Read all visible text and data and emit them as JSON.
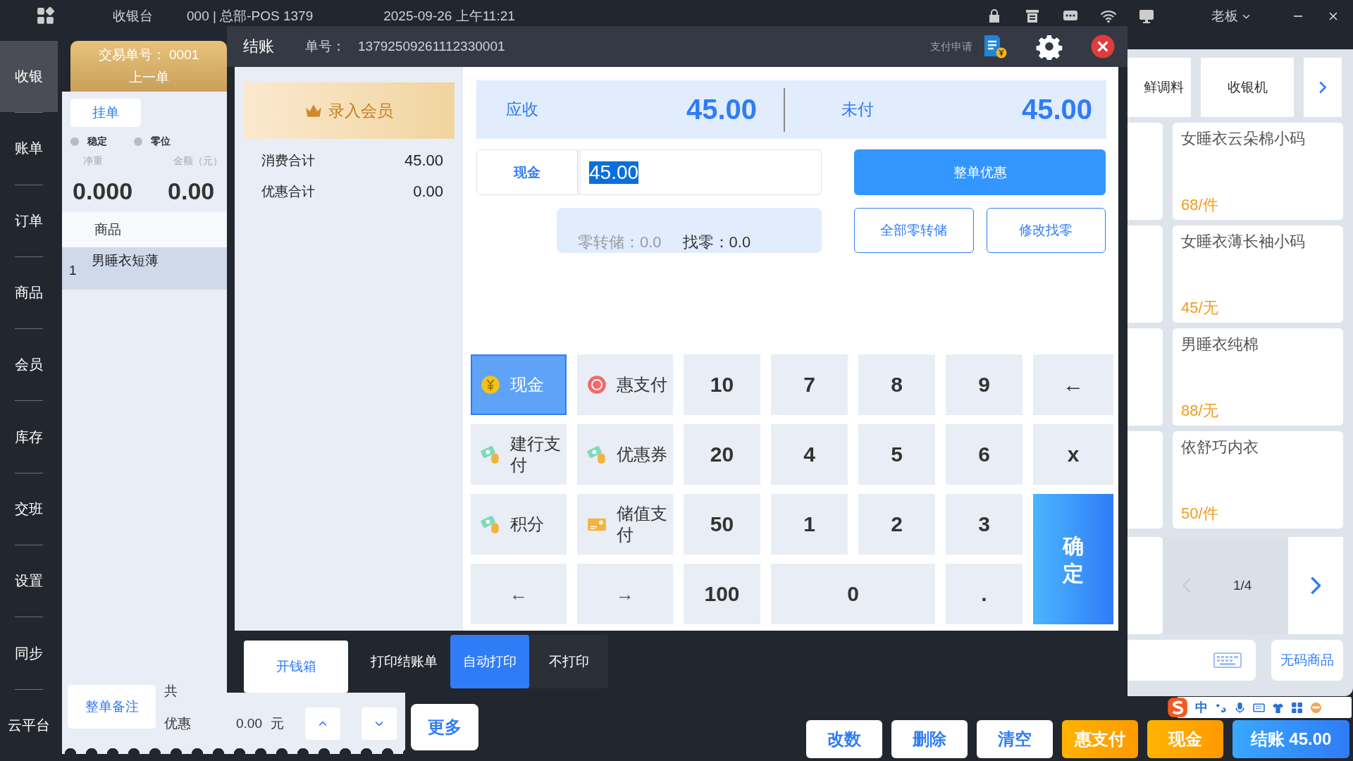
{
  "top_bar": {
    "app": "收银台",
    "terminal": "000 | 总部-POS 1379",
    "datetime": "2025-09-26 上午11:21",
    "user": "老板"
  },
  "sidebar": [
    {
      "label": "收银",
      "selected": true
    },
    {
      "label": "账单",
      "selected": false
    },
    {
      "label": "订单",
      "selected": false
    },
    {
      "label": "商品",
      "selected": false
    },
    {
      "label": "会员",
      "selected": false
    },
    {
      "label": "库存",
      "selected": false
    },
    {
      "label": "交班",
      "selected": false
    },
    {
      "label": "设置",
      "selected": false
    },
    {
      "label": "同步",
      "selected": false
    },
    {
      "label": "云平台",
      "selected": false
    }
  ],
  "ticket": {
    "number": "交易单号： 0001",
    "prev": "上一单",
    "hold": "挂单",
    "indicators": [
      {
        "label": "稳定",
        "on": false
      },
      {
        "label": "零位",
        "on": false
      }
    ],
    "weight_label": "净重",
    "amount_label": "金额（元）",
    "weight": "0.000",
    "amount": "0.00",
    "column": "商品",
    "rows": [
      {
        "index": "1",
        "name": "男睡衣短薄",
        "selected": true
      }
    ],
    "note_button": "整单备注",
    "count_label": "共",
    "discount_label": "优惠",
    "discount": "0.00",
    "unit": "元"
  },
  "checkout": {
    "title": "结账",
    "order_label": "单号：",
    "order_no": "13792509261112330001",
    "pay_request": "支付申请",
    "member_button": "录入会员",
    "totals": [
      {
        "label": "消费合计",
        "value": "45.00"
      },
      {
        "label": "优惠合计",
        "value": "0.00"
      }
    ],
    "receivable_label": "应收",
    "receivable": "45.00",
    "unpaid_label": "未付",
    "unpaid": "45.00",
    "method": "现金",
    "amount": "45.00",
    "change_store": "零转储：0.0",
    "change": "找零：0.0",
    "discount_button": "整单优惠",
    "store_all_button": "全部零转储",
    "edit_change_button": "修改找零",
    "keys": [
      {
        "label": "现金",
        "kind": "coin",
        "selected": true
      },
      {
        "label": "惠支付",
        "kind": "promo",
        "selected": false
      },
      {
        "label": "10",
        "kind": "digit"
      },
      {
        "label": "7",
        "kind": "digit"
      },
      {
        "label": "8",
        "kind": "digit"
      },
      {
        "label": "9",
        "kind": "digit"
      },
      {
        "label": "←",
        "kind": "digit"
      },
      {
        "label": "建行支付",
        "kind": "wallet",
        "selected": false
      },
      {
        "label": "优惠券",
        "kind": "wallet",
        "selected": false
      },
      {
        "label": "20",
        "kind": "digit"
      },
      {
        "label": "4",
        "kind": "digit"
      },
      {
        "label": "5",
        "kind": "digit"
      },
      {
        "label": "6",
        "kind": "digit"
      },
      {
        "label": "x",
        "kind": "digit"
      },
      {
        "label": "积分",
        "kind": "wallet",
        "selected": false
      },
      {
        "label": "储值支付",
        "kind": "card",
        "selected": false
      },
      {
        "label": "50",
        "kind": "digit"
      },
      {
        "label": "1",
        "kind": "digit"
      },
      {
        "label": "2",
        "kind": "digit"
      },
      {
        "label": "3",
        "kind": "digit"
      },
      {
        "label": "确定",
        "kind": "confirm"
      },
      {
        "label": "←",
        "kind": "arrow"
      },
      {
        "label": "→",
        "kind": "arrow"
      },
      {
        "label": "100",
        "kind": "digit"
      },
      {
        "label": "0",
        "kind": "wide"
      },
      {
        "label": ".",
        "kind": "digit"
      }
    ],
    "open_drawer": "开钱箱",
    "print_label": "打印结账单",
    "print_options": [
      {
        "label": "自动打印",
        "selected": true
      },
      {
        "label": "不打印",
        "selected": false
      }
    ]
  },
  "catalog": {
    "categories": [
      "鲜调料",
      "收银机"
    ],
    "products": [
      {
        "name": "女睡衣云朵棉小码",
        "price": "68/件"
      },
      {
        "name": "女睡衣薄长袖小码",
        "price": "45/无"
      },
      {
        "name": "男睡衣纯棉",
        "price": "88/无"
      },
      {
        "name": "依舒巧内衣",
        "price": "50/件"
      }
    ],
    "page": "1/4",
    "no_code_button": "无码商品"
  },
  "bottom_bar": {
    "more": "更多",
    "actions": [
      {
        "label": "改数",
        "kind": "plain"
      },
      {
        "label": "删除",
        "kind": "plain"
      },
      {
        "label": "清空",
        "kind": "plain"
      },
      {
        "label": "惠支付",
        "kind": "orange"
      },
      {
        "label": "现金",
        "kind": "orange"
      },
      {
        "label": "结账 45.00",
        "kind": "primary"
      }
    ]
  },
  "ime_bar": {
    "mode": "中"
  }
}
